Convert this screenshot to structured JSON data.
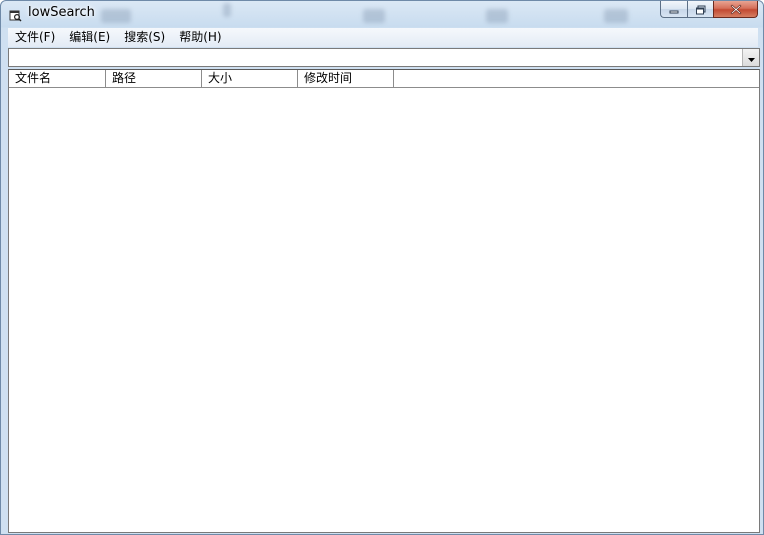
{
  "window": {
    "title": "lowSearch",
    "icon": "search-app-icon"
  },
  "caption": {
    "minimize_icon": "minimize-icon",
    "maximize_icon": "restore-icon",
    "close_icon": "close-icon"
  },
  "menu": {
    "items": [
      {
        "label": "文件(F)"
      },
      {
        "label": "编辑(E)"
      },
      {
        "label": "搜索(S)"
      },
      {
        "label": "帮助(H)"
      }
    ]
  },
  "search": {
    "value": "",
    "dropdown_icon": "chevron-down-icon"
  },
  "table": {
    "columns": [
      {
        "label": "文件名"
      },
      {
        "label": "路径"
      },
      {
        "label": "大小"
      },
      {
        "label": "修改时间"
      }
    ],
    "rows": []
  },
  "colors": {
    "titlebar": "#c8dcef",
    "close_button": "#c24a33",
    "window_border": "#6f8aa8"
  }
}
